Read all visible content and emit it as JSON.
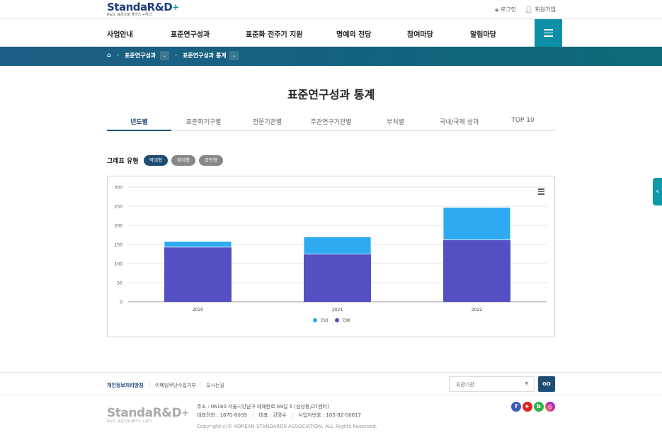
{
  "header": {
    "logo_main": "StandaR&D",
    "logo_plus": "+",
    "logo_sub": "R&D, 표준으로 플러스 +하다",
    "login_label": "로그인",
    "signup_label": "회원가입"
  },
  "gnb": {
    "items": [
      "사업안내",
      "표준연구성과",
      "표준화 전주기 지원",
      "명예의 전당",
      "참여마당",
      "알림마당"
    ]
  },
  "breadcrumb": {
    "home": "⌂",
    "level1": "표준연구성과",
    "level2": "표준연구성과 통계"
  },
  "page_title": "표준연구성과 통계",
  "tabs": [
    "년도별",
    "표준화기구별",
    "전문기관별",
    "주관연구기관별",
    "부처별",
    "국내/국제 성과",
    "TOP 10"
  ],
  "active_tab": "년도별",
  "graph_type": {
    "label": "그래프 유형",
    "options": [
      "막대형",
      "파이형",
      "라인형"
    ],
    "selected": "막대형"
  },
  "colors": {
    "domestic": "#2eaaf3",
    "international": "#5450c4",
    "accent": "#0e8fa8",
    "navy": "#1e4d73"
  },
  "chart_data": {
    "type": "bar",
    "stacked": true,
    "categories": [
      "2020",
      "2021",
      "2022"
    ],
    "series": [
      {
        "name": "국내",
        "values": [
          15,
          45,
          85
        ]
      },
      {
        "name": "국제",
        "values": [
          143,
          125,
          162
        ]
      }
    ],
    "ylim": [
      0,
      300
    ],
    "yticks": [
      0,
      50,
      100,
      150,
      200,
      250,
      300
    ],
    "grid": true,
    "legend_position": "bottom"
  },
  "footer": {
    "links": [
      "개인정보처리방침",
      "이메일무단수집거부",
      "오시는길"
    ],
    "select_placeholder": "유관기관",
    "go_label": "GO",
    "logo_main": "StandaR&D",
    "logo_plus": "+",
    "logo_sub": "R&D, 표준으로 플러스 +하다",
    "address": "주소 : 06160 서울시강남구 테헤란로 69길 5 (삼성동,DT센터)",
    "phone": "대표전화 : 1670-6009",
    "ceo": "대표 : 강명수",
    "biz_no": "사업자번호 : 105-82-00617",
    "copyright": "Copyright(c)© KOREAN STANDARDS ASSOCIATION. ALL Rights Reserved.",
    "social": [
      "f",
      "▶",
      "b",
      "◎"
    ]
  },
  "side_tab_icon": "‹"
}
